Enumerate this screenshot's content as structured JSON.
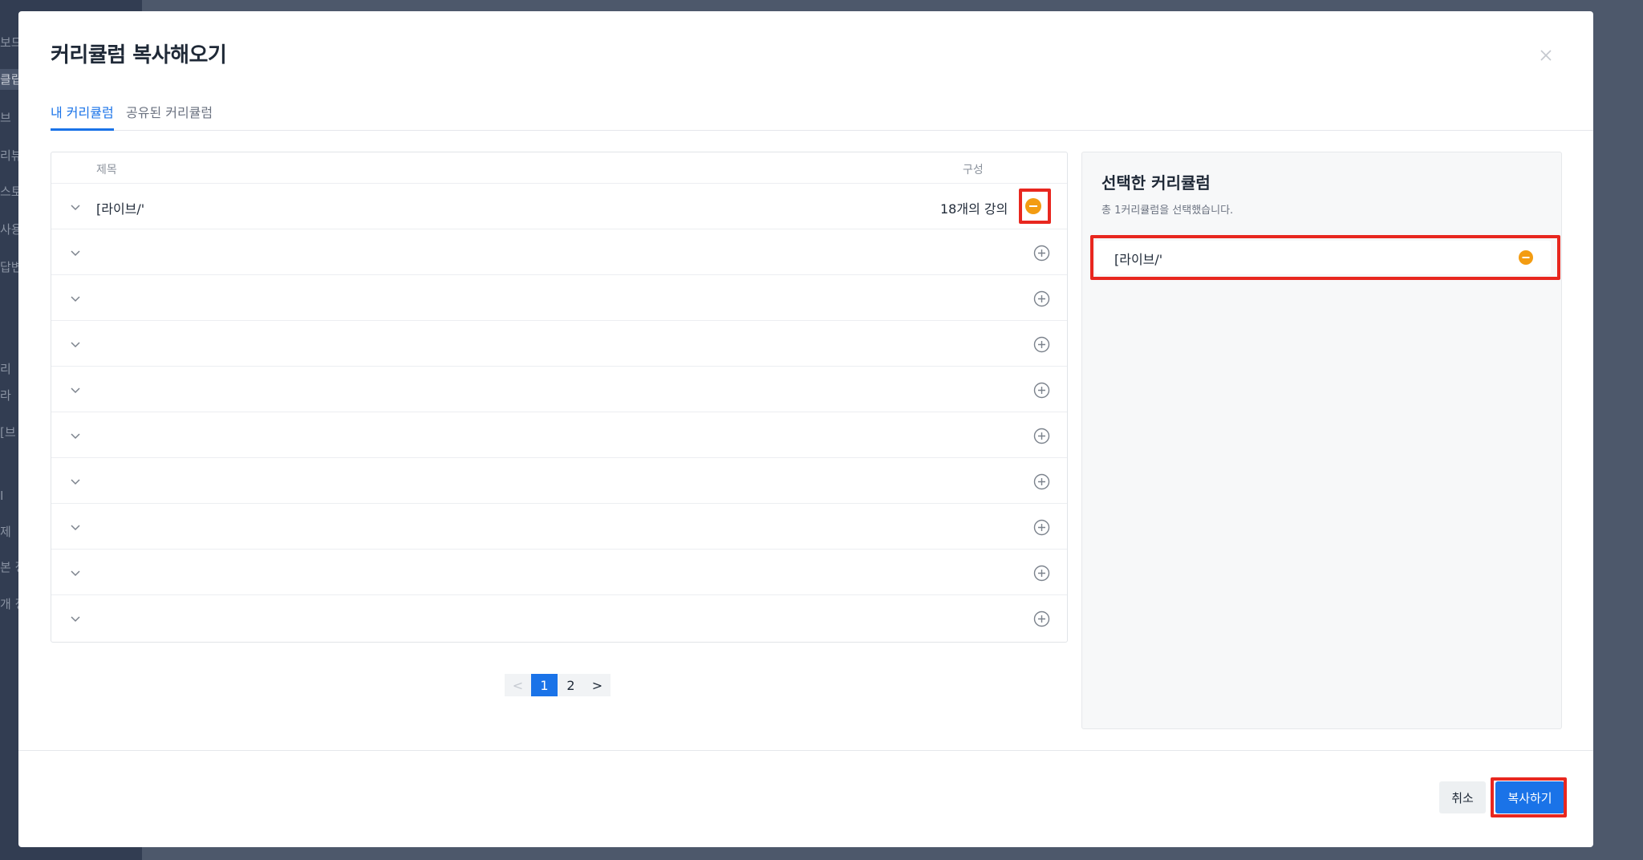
{
  "background": {
    "sidebar_items": [
      {
        "label": "보드",
        "active": false
      },
      {
        "label": "클립",
        "active": true
      },
      {
        "label": "브",
        "active": false
      },
      {
        "label": "리뷰",
        "active": false
      },
      {
        "label": "스토",
        "active": false
      },
      {
        "label": "사용",
        "active": false
      },
      {
        "label": "답변",
        "active": false
      },
      {
        "label": "리",
        "active": false
      },
      {
        "label": "라",
        "active": false
      },
      {
        "label": "[브",
        "active": false
      },
      {
        "label": "I",
        "active": false
      },
      {
        "label": "제",
        "active": false
      },
      {
        "label": "본 정",
        "active": false
      },
      {
        "label": "개 정",
        "active": false
      }
    ]
  },
  "modal": {
    "title": "커리큘럼 복사해오기",
    "tabs": [
      {
        "label": "내 커리큘럼",
        "active": true
      },
      {
        "label": "공유된 커리큘럼",
        "active": false
      }
    ]
  },
  "table": {
    "columns": {
      "title": "제목",
      "composition": "구성"
    },
    "rows": [
      {
        "title": "[라이브/'",
        "composition": "18개의 강의",
        "selected": true
      },
      {
        "title": "",
        "composition": "",
        "selected": false
      },
      {
        "title": "",
        "composition": "",
        "selected": false
      },
      {
        "title": "",
        "composition": "",
        "selected": false
      },
      {
        "title": "",
        "composition": "",
        "selected": false
      },
      {
        "title": "",
        "composition": "",
        "selected": false
      },
      {
        "title": "",
        "composition": "",
        "selected": false
      },
      {
        "title": "",
        "composition": "",
        "selected": false
      },
      {
        "title": "",
        "composition": "",
        "selected": false
      },
      {
        "title": "",
        "composition": "",
        "selected": false
      }
    ]
  },
  "pagination": {
    "prev": "<",
    "pages": [
      "1",
      "2"
    ],
    "current": "1",
    "next": ">"
  },
  "selected_panel": {
    "title": "선택한 커리큘럼",
    "summary": "총 1커리큘럼을 선택했습니다.",
    "items": [
      {
        "title": "[라이브/'"
      }
    ]
  },
  "footer": {
    "cancel_label": "취소",
    "copy_label": "복사하기"
  },
  "colors": {
    "accent": "#1a73e8",
    "remove_icon": "#f39c12",
    "annotation": "#e8271f"
  },
  "icons": {
    "close": "close-icon",
    "expand": "chevron-down-icon",
    "add": "plus-circle-icon",
    "remove": "minus-circle-icon"
  }
}
